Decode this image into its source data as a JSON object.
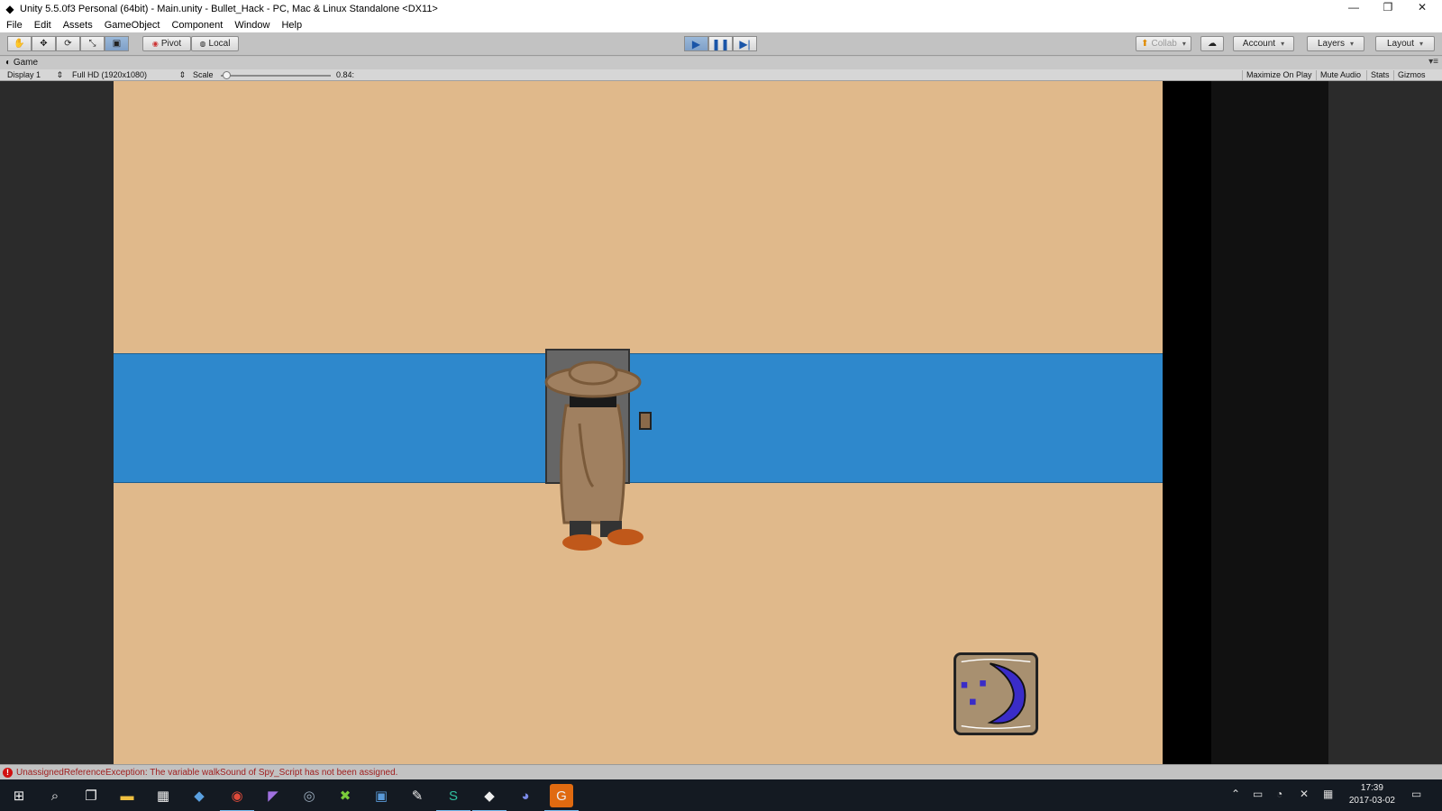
{
  "window": {
    "title": "Unity 5.5.0f3 Personal (64bit) - Main.unity - Bullet_Hack - PC, Mac & Linux Standalone <DX11>"
  },
  "menu": [
    "File",
    "Edit",
    "Assets",
    "GameObject",
    "Component",
    "Window",
    "Help"
  ],
  "toolbar": {
    "pivot": "Pivot",
    "local": "Local",
    "collab": "Collab",
    "account": "Account",
    "layers": "Layers",
    "layout": "Layout"
  },
  "game_tab": {
    "label": "Game",
    "display": "Display 1",
    "resolution": "Full HD (1920x1080)",
    "scale_label": "Scale",
    "scale_value": "0.84:",
    "scale_fraction": 0.05,
    "maximize": "Maximize On Play",
    "mute": "Mute Audio",
    "stats": "Stats",
    "gizmos": "Gizmos"
  },
  "status": {
    "message": "UnassignedReferenceException: The variable walkSound of Spy_Script has not been assigned."
  },
  "taskbar": {
    "time": "17:39",
    "date": "2017-03-02"
  },
  "colors": {
    "scene_bg": "#e0b98b",
    "road": "#2e88cc",
    "error": "#d01010"
  }
}
